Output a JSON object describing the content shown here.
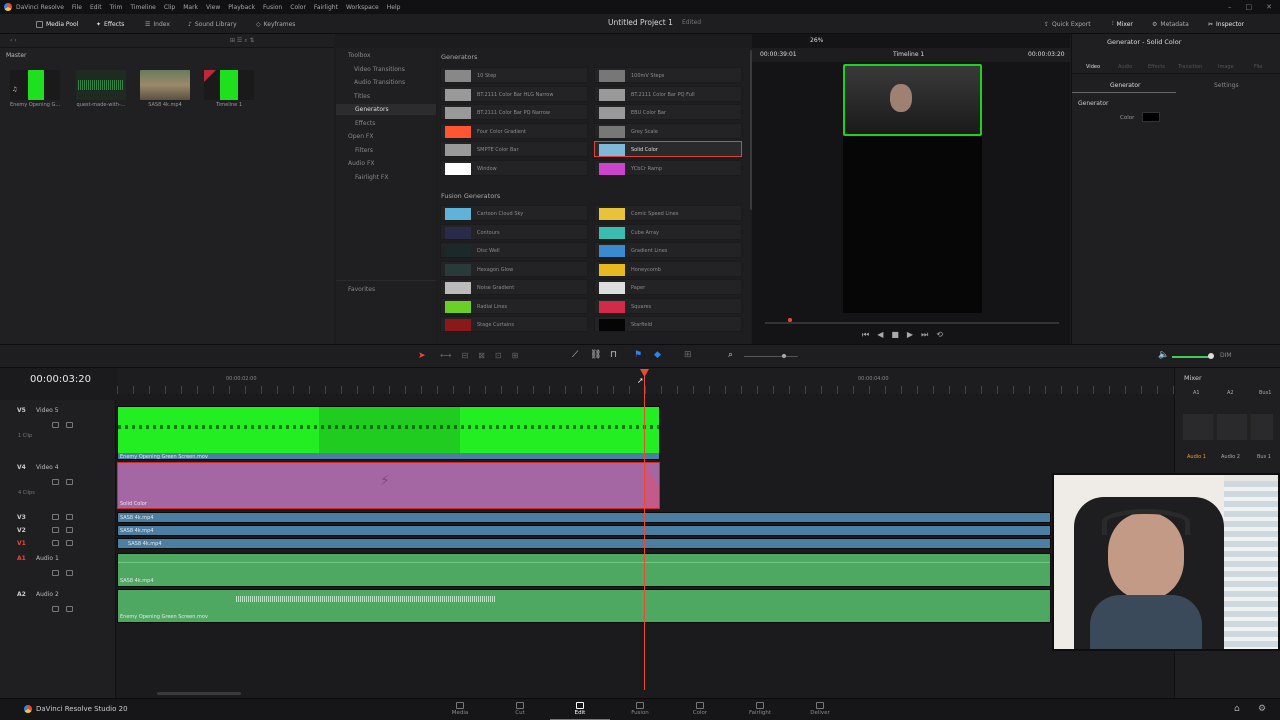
{
  "menubar": {
    "app": "DaVinci Resolve",
    "items": [
      "File",
      "Edit",
      "Trim",
      "Timeline",
      "Clip",
      "Mark",
      "View",
      "Playback",
      "Fusion",
      "Color",
      "Fairlight",
      "Workspace",
      "Help"
    ]
  },
  "toolbar": {
    "left": [
      "Media Pool",
      "Effects",
      "Index",
      "Sound Library",
      "Keyframes"
    ],
    "project_title": "Untitled Project 1",
    "project_status": "Edited",
    "right": [
      "Quick Export",
      "Mixer",
      "Metadata",
      "Inspector"
    ]
  },
  "media_pool": {
    "bin": "Master",
    "clips": [
      {
        "name": "Enemy Opening G...",
        "kind": "video"
      },
      {
        "name": "quest-made-with-...",
        "kind": "audio"
      },
      {
        "name": "SAS8 4k.mp4",
        "kind": "image"
      },
      {
        "name": "Timeline 1",
        "kind": "timeline"
      }
    ]
  },
  "effects_tree": {
    "items": [
      {
        "label": "Toolbox",
        "selected": false
      },
      {
        "label": "Video Transitions",
        "selected": false
      },
      {
        "label": "Audio Transitions",
        "selected": false
      },
      {
        "label": "Titles",
        "selected": false
      },
      {
        "label": "Generators",
        "selected": true
      },
      {
        "label": "Effects",
        "selected": false
      },
      {
        "label": "Open FX",
        "selected": false
      },
      {
        "label": "Filters",
        "selected": false
      },
      {
        "label": "Audio FX",
        "selected": false
      },
      {
        "label": "Fairlight FX",
        "selected": false
      }
    ],
    "favorites": "Favorites"
  },
  "generators": {
    "header": "Generators",
    "items": [
      {
        "label": "10 Step",
        "color": "#888888"
      },
      {
        "label": "100mV Steps",
        "color": "#777777"
      },
      {
        "label": "BT.2111 Color Bar HLG Narrow",
        "color": "#999999"
      },
      {
        "label": "BT.2111 Color Bar PQ Full",
        "color": "#999999"
      },
      {
        "label": "BT.2111 Color Bar PQ Narrow",
        "color": "#999999"
      },
      {
        "label": "EBU Color Bar",
        "color": "#999999"
      },
      {
        "label": "Four Color Gradient",
        "color": "#ff5533"
      },
      {
        "label": "Grey Scale",
        "color": "#777777"
      },
      {
        "label": "SMPTE Color Bar",
        "color": "#999999"
      },
      {
        "label": "Solid Color",
        "color": "#7fb8d8"
      },
      {
        "label": "Window",
        "color": "#ffffff"
      },
      {
        "label": "YCbCr Ramp",
        "color": "#cc44cc"
      }
    ],
    "selected": "Solid Color"
  },
  "fusion_generators": {
    "header": "Fusion Generators",
    "items": [
      {
        "label": "Cartoon Cloud Sky",
        "color": "#5fb3d9"
      },
      {
        "label": "Comic Speed Lines",
        "color": "#e8c23a"
      },
      {
        "label": "Contours",
        "color": "#2a2a4a"
      },
      {
        "label": "Cube Array",
        "color": "#3bbcb0"
      },
      {
        "label": "Disc Well",
        "color": "#1a2a2a"
      },
      {
        "label": "Gradient Lines",
        "color": "#3a8ad0"
      },
      {
        "label": "Hexagon Glow",
        "color": "#2a3a3a"
      },
      {
        "label": "Honeycomb",
        "color": "#e8b820"
      },
      {
        "label": "Noise Gradient",
        "color": "#bbbbbb"
      },
      {
        "label": "Paper",
        "color": "#dddddd"
      },
      {
        "label": "Radial Lines",
        "color": "#6ad028"
      },
      {
        "label": "Squares",
        "color": "#d42a4a"
      },
      {
        "label": "Stage Curtains",
        "color": "#8a1a1a"
      },
      {
        "label": "Starfield",
        "color": "#050505"
      }
    ]
  },
  "viewer": {
    "timecode_left": "00:00:39:01",
    "zoom": "26%",
    "timeline_name": "Timeline 1",
    "timecode_right": "00:00:03:20"
  },
  "inspector": {
    "title": "Generator - Solid Color",
    "tabs": [
      "Video",
      "Audio",
      "Effects",
      "Transition",
      "Image",
      "File"
    ],
    "subtabs": [
      "Generator",
      "Settings"
    ],
    "section": "Generator",
    "color_label": "Color",
    "color_value": "#000000"
  },
  "timeline": {
    "timecode": "00:00:03:20",
    "ruler_labels": [
      "00:00:02:00",
      "00:00:04:00"
    ],
    "tracks": [
      {
        "code": "V5",
        "name": "Video 5",
        "sub": "1 Clip"
      },
      {
        "code": "V4",
        "name": "Video 4",
        "sub": "4 Clips"
      },
      {
        "code": "V3",
        "name": "",
        "sub": ""
      },
      {
        "code": "V2",
        "name": "",
        "sub": ""
      },
      {
        "code": "V1",
        "name": "",
        "sub": ""
      },
      {
        "code": "A1",
        "name": "Audio 1",
        "sub": ""
      },
      {
        "code": "A2",
        "name": "Audio 2",
        "sub": ""
      }
    ],
    "clips": {
      "v5": "Enemy Opening Green Screen.mov",
      "v4": "Solid Color",
      "v3": "SAS8 4k.mp4",
      "v2": "SAS8 4k.mp4",
      "v1": "SAS8 4k.mp4",
      "a1": "SAS8 4k.mp4",
      "a2": "Enemy Opening Green Screen.mov"
    },
    "colors": {
      "green": "#22ee22",
      "purple": "#a467a4",
      "blue": "#4a7fa3",
      "audio": "#4fa862"
    }
  },
  "mixer": {
    "title": "Mixer",
    "channels": [
      "A1",
      "A2",
      "Bus1"
    ],
    "labels": [
      "Audio 1",
      "Audio 2",
      "Bus 1"
    ],
    "dim": "DIM"
  },
  "bottombar": {
    "brand": "DaVinci Resolve Studio 20",
    "pages": [
      "Media",
      "Cut",
      "Edit",
      "Fusion",
      "Color",
      "Fairlight",
      "Deliver"
    ],
    "active": "Edit"
  }
}
